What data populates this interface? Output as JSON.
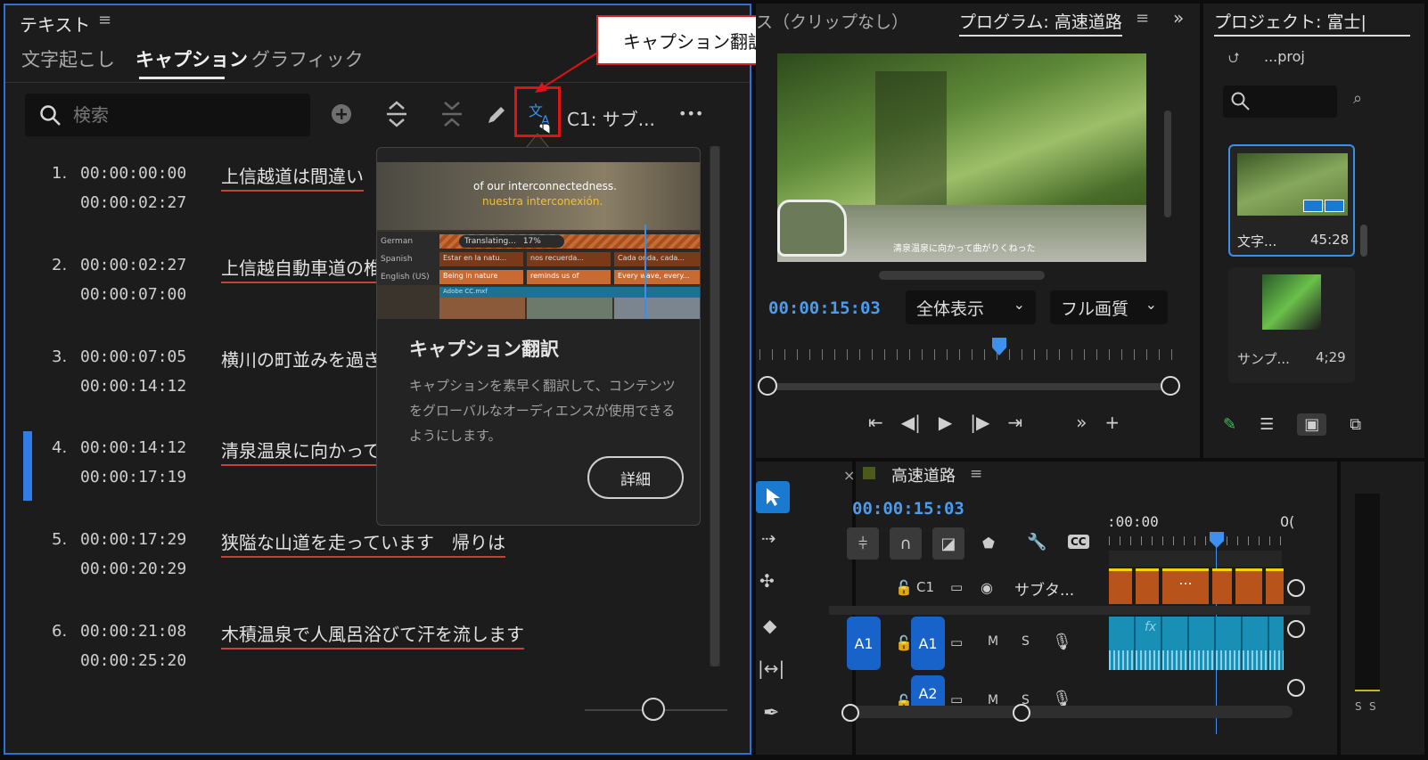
{
  "text_panel": {
    "title": "テキスト",
    "menu_icon": "≡",
    "tabs": [
      {
        "label": "文字起こし",
        "active": false
      },
      {
        "label": "キャプション",
        "active": true
      },
      {
        "label": "グラフィック",
        "active": false
      }
    ],
    "search_placeholder": "検索",
    "track_label": "C1: サブ...",
    "more_label": "•••",
    "captions": [
      {
        "num": "1.",
        "in": "00:00:00:00",
        "out": "00:00:02:27",
        "text": "上信越道は間違い",
        "underlined": true
      },
      {
        "num": "2.",
        "in": "00:00:02:27",
        "out": "00:00:07:00",
        "text": "上信越自動車道の椎",
        "underlined": true
      },
      {
        "num": "3.",
        "in": "00:00:07:05",
        "out": "00:00:14:12",
        "text": "横川の町並みを過ぎ",
        "underlined": false
      },
      {
        "num": "4.",
        "in": "00:00:14:12",
        "out": "00:00:17:19",
        "text": "清泉温泉に向かって",
        "underlined": true,
        "selected": true
      },
      {
        "num": "5.",
        "in": "00:00:17:29",
        "out": "00:00:20:29",
        "text": "狭隘な山道を走っています　帰りは",
        "underlined": true
      },
      {
        "num": "6.",
        "in": "00:00:21:08",
        "out": "00:00:25:20",
        "text": "木積温泉で人風呂浴びて汗を流します",
        "underlined": true
      }
    ]
  },
  "popover": {
    "image_lines": [
      "of our interconnectedness.",
      "nuestra interconexión."
    ],
    "lang_rows": [
      "German",
      "Spanish",
      "English (US)"
    ],
    "progress_label": "Translating...",
    "progress_percent": "17%",
    "cells_es": [
      "Estar en la natu...",
      "nos recuerda...",
      "Cada onda, cada..."
    ],
    "cells_en": [
      "Being in nature",
      "reminds us of",
      "Every wave, every..."
    ],
    "clip_name": "Adobe CC.mxf",
    "title": "キャプション翻訳",
    "description": "キャプションを素早く翻訳して、コンテンツをグローバルなオーディエンスが使用できるようにします。",
    "more_button": "詳細"
  },
  "callout": {
    "label": "キャプション翻訳"
  },
  "program_monitor": {
    "source_tab": "ス（クリップなし）",
    "program_tab": "プログラム: 高速道路",
    "timecode": "00:00:15:03",
    "zoom_select": "全体表示",
    "quality_select": "フル画質",
    "subtitle_burned": "清泉温泉に向かって曲がりくねった"
  },
  "project_panel": {
    "title": "プロジェクト: 富士|",
    "path": "...proj",
    "items": [
      {
        "name": "文字...",
        "duration": "45:28"
      },
      {
        "name": "サンプ...",
        "duration": "4;29"
      }
    ]
  },
  "timeline": {
    "sequence_name": "高速道路",
    "timecode": "00:00:15:03",
    "ruler_start": ":00:00",
    "ruler_end": "0(",
    "tracks": [
      {
        "target": "",
        "id": "C1",
        "label": "サブタ...",
        "clip_label": "..."
      },
      {
        "target": "A1",
        "id": "A1",
        "m": "M",
        "s": "S"
      },
      {
        "target": "",
        "id": "A2",
        "m": "M",
        "s": "S"
      }
    ],
    "fx_label": "fx",
    "cc_label": "CC"
  },
  "meter": {
    "labels": [
      "S",
      "S"
    ]
  },
  "colors": {
    "accent": "#2f6fd6",
    "timecode": "#4a9cf0",
    "caption_clip": "#b8531c",
    "audio_clip": "#1a8fb5",
    "track_target": "#1863c9",
    "highlight": "#e01212"
  }
}
